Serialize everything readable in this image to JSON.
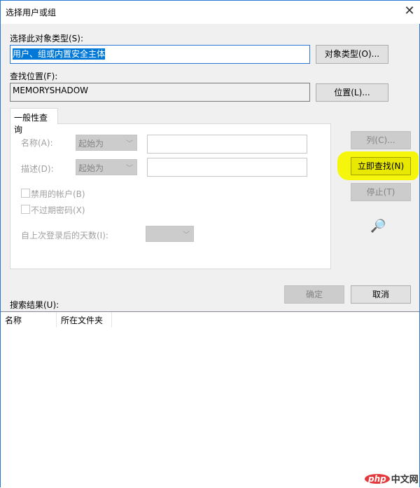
{
  "window": {
    "title": "选择用户或组"
  },
  "object_type": {
    "label": "选择此对象类型(S):",
    "value": "用户、组或内置安全主体",
    "button": "对象类型(O)..."
  },
  "location": {
    "label": "查找位置(F):",
    "value": "MEMORYSHADOW",
    "button": "位置(L)..."
  },
  "tab": {
    "label": "一般性查询"
  },
  "query": {
    "name_label": "名称(A):",
    "name_mode": "起始为",
    "name_value": "",
    "desc_label": "描述(D):",
    "desc_mode": "起始为",
    "desc_value": "",
    "disabled_accounts": "禁用的帐户(B)",
    "no_expire_password": "不过期密码(X)",
    "days_label": "自上次登录后的天数(I):",
    "days_value": ""
  },
  "buttons": {
    "columns": "列(C)...",
    "find_now": "立即查找(N)",
    "stop": "停止(T)",
    "ok": "确定",
    "cancel": "取消"
  },
  "results": {
    "label": "搜索结果(U):",
    "columns": [
      "名称",
      "所在文件夹"
    ]
  },
  "watermark": {
    "logo": "php",
    "text": "中文网"
  },
  "colors": {
    "highlight": "#f6f600",
    "accent": "#0078d7"
  }
}
